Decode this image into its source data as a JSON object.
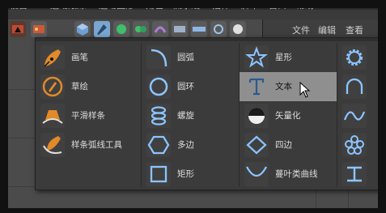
{
  "menubar": {
    "items": [
      "视窗",
      "运动跟踪",
      "运动图形",
      "角色",
      "流水线",
      "插件",
      "脚本",
      "窗口",
      "帮助"
    ]
  },
  "right_panel": {
    "tabs": [
      "文件",
      "编辑",
      "查看"
    ]
  },
  "popup": {
    "columns": [
      {
        "items": [
          {
            "label": "画笔",
            "icon": "pen-icon"
          },
          {
            "label": "草绘",
            "icon": "sketch-icon"
          },
          {
            "label": "平滑样条",
            "icon": "smooth-spline-icon"
          },
          {
            "label": "样条弧线工具",
            "icon": "arc-tool-icon"
          }
        ]
      },
      {
        "items": [
          {
            "label": "圆弧",
            "icon": "arc-icon"
          },
          {
            "label": "圆环",
            "icon": "circle-icon"
          },
          {
            "label": "螺旋",
            "icon": "helix-icon"
          },
          {
            "label": "多边",
            "icon": "polygon-icon"
          },
          {
            "label": "矩形",
            "icon": "rectangle-icon"
          }
        ]
      },
      {
        "items": [
          {
            "label": "星形",
            "icon": "star-icon"
          },
          {
            "label": "文本",
            "icon": "text-icon"
          },
          {
            "label": "矢量化",
            "icon": "vectorize-icon"
          },
          {
            "label": "四边",
            "icon": "diamond-icon"
          },
          {
            "label": "蔓叶类曲线",
            "icon": "cissoid-icon"
          }
        ]
      },
      {
        "items": [
          {
            "label": "",
            "icon": "cog-shape-icon"
          },
          {
            "label": "",
            "icon": "arch-icon"
          },
          {
            "label": "",
            "icon": "wave-icon"
          },
          {
            "label": "",
            "icon": "flower-icon"
          },
          {
            "label": "",
            "icon": "profile-icon"
          }
        ]
      }
    ],
    "highlighted": "文本"
  },
  "colors": {
    "accent": "#7aa6cf",
    "highlight": "#8f8f8f",
    "icon_orange": "#e08a2a"
  }
}
